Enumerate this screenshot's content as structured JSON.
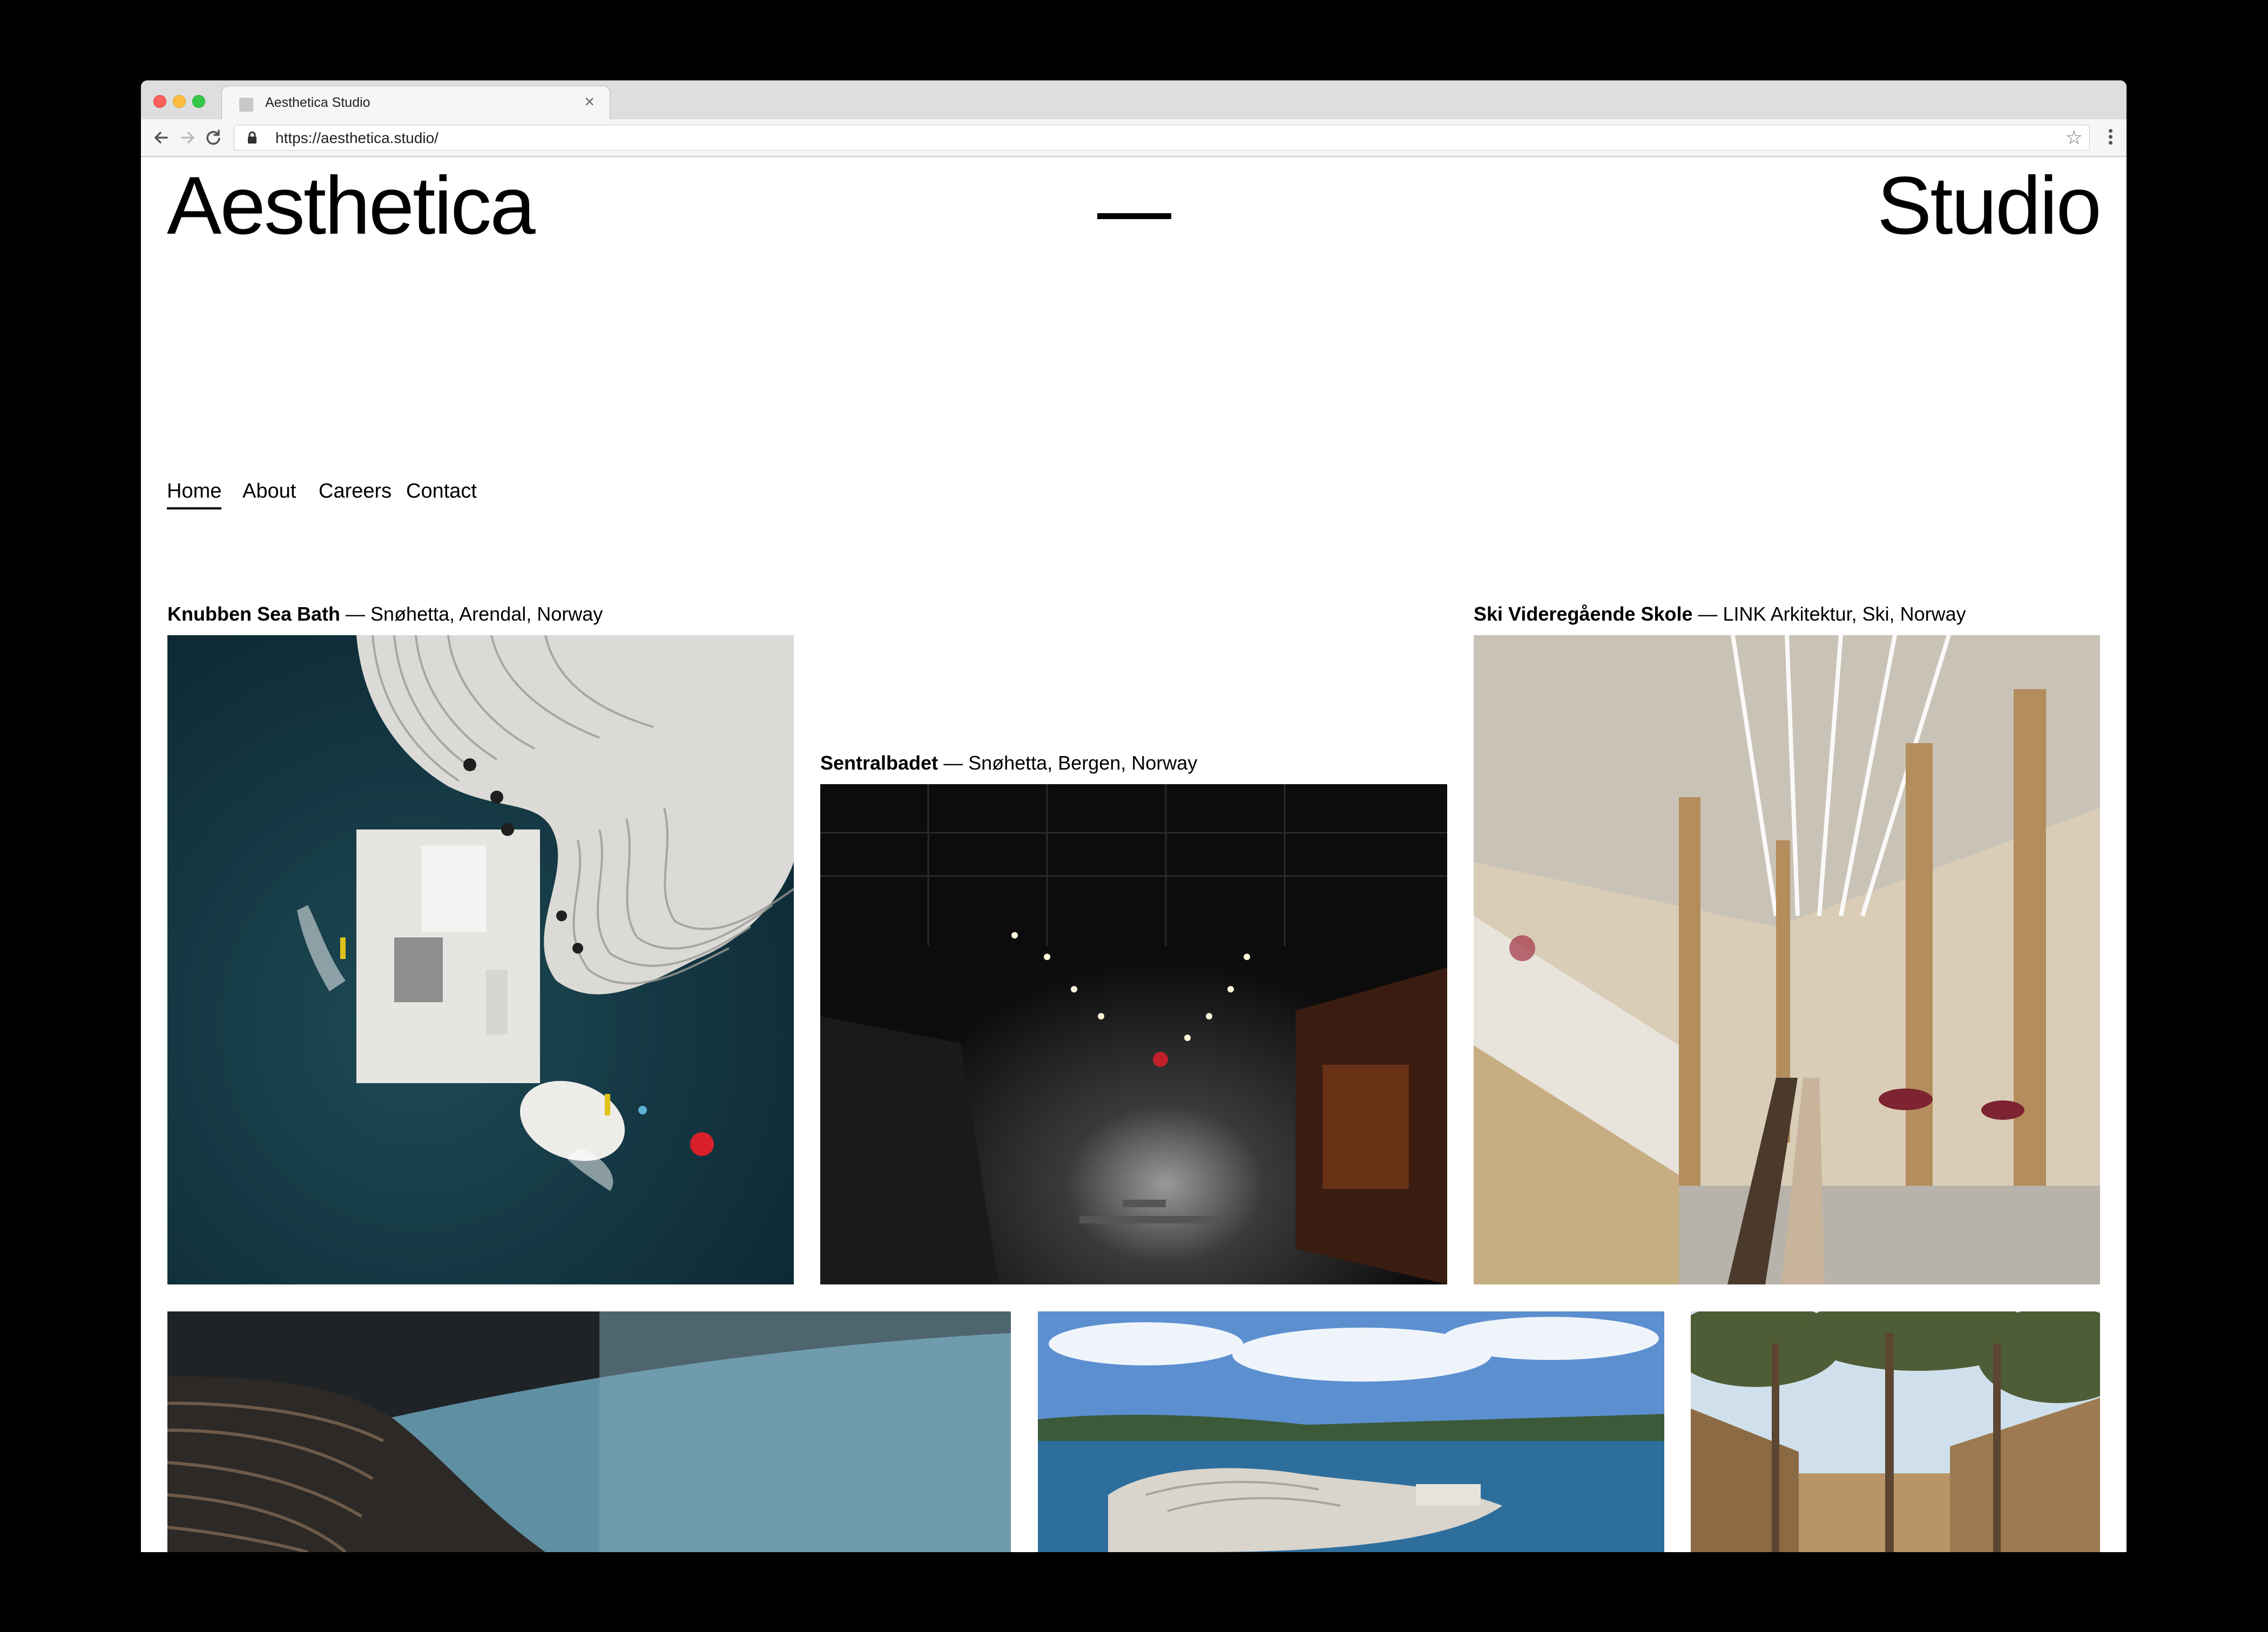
{
  "browser": {
    "tab_title": "Aesthetica Studio",
    "tab_close": "×",
    "url": "https://aesthetica.studio/",
    "star": "☆"
  },
  "site": {
    "logo_left": "Aesthetica",
    "logo_right": "Studio"
  },
  "nav": {
    "items": [
      {
        "label": "Home",
        "active": true
      },
      {
        "label": "About",
        "active": false
      },
      {
        "label": "Careers",
        "active": false
      },
      {
        "label": "Contact",
        "active": false
      }
    ]
  },
  "projects": [
    {
      "name": "Knubben Sea Bath",
      "details": " — Snøhetta, Arendal, Norway"
    },
    {
      "name": "Sentralbadet",
      "details": " — Snøhetta, Bergen, Norway"
    },
    {
      "name": "Ski Videregående Skole",
      "details": " — LINK Arkitektur, Ski, Norway"
    },
    {
      "name": "",
      "details": ""
    },
    {
      "name": "",
      "details": ""
    },
    {
      "name": "",
      "details": ""
    }
  ]
}
